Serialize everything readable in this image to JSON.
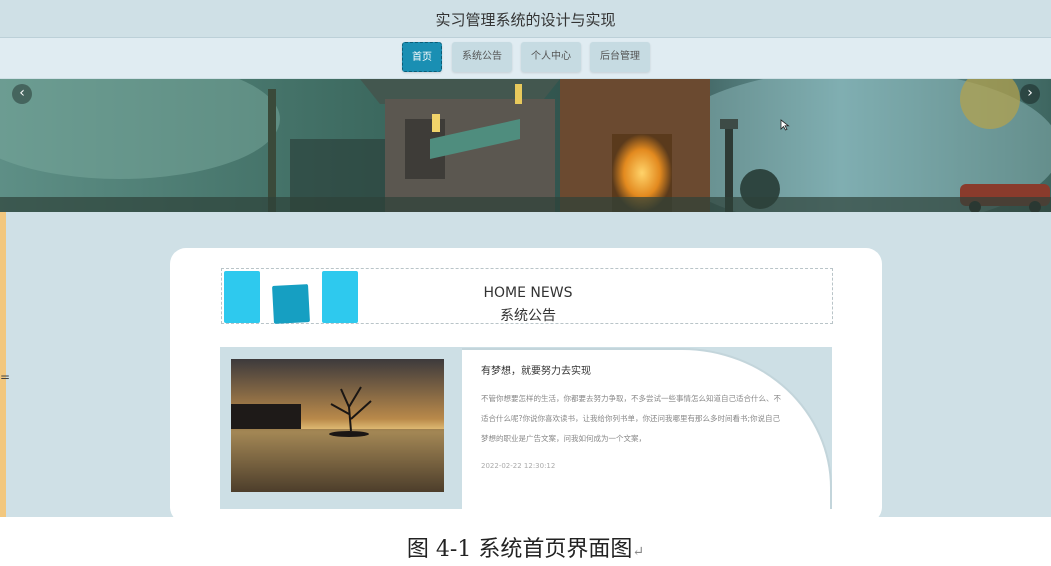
{
  "header": {
    "title": "实习管理系统的设计与实现"
  },
  "nav": {
    "items": [
      {
        "label": "首页",
        "active": true
      },
      {
        "label": "系统公告",
        "active": false
      },
      {
        "label": "个人中心",
        "active": false
      },
      {
        "label": "后台管理",
        "active": false
      }
    ]
  },
  "carousel": {
    "prev_icon": "‹",
    "next_icon": "›"
  },
  "left_edge_mark": "=",
  "news_section": {
    "title_en": "HOME NEWS",
    "title_cn": "系统公告",
    "items": [
      {
        "title": "有梦想，就要努力去实现",
        "body": "不管你想要怎样的生活，你都要去努力争取，不多尝试一些事情怎么知道自己适合什么、不适合什么呢?你说你喜欢读书，让我给你列书单，你还问我哪里有那么多时间看书;你说自己梦想的职业是广告文案，问我如何成为一个文案，",
        "date": "2022-02-22 12:30:12"
      }
    ]
  },
  "caption": {
    "text": "图 4-1 系统首页界面图",
    "return_mark": "↵"
  },
  "colors": {
    "accent": "#1a8fb3",
    "background": "#cfe0e6",
    "edge": "#f2c77e"
  }
}
